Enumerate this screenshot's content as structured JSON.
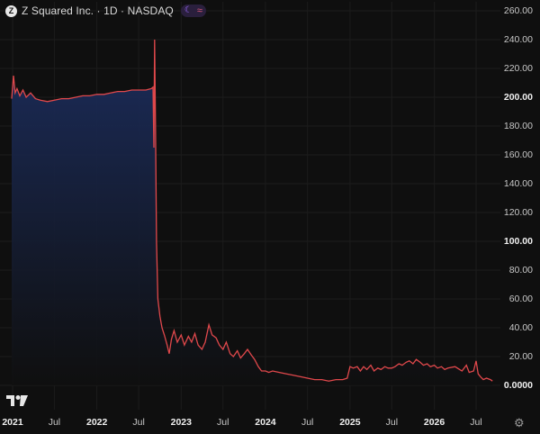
{
  "header": {
    "logo_letter": "Z",
    "title": "Z Squared Inc. · 1D · NASDAQ",
    "moon_icon": "moon-icon",
    "wave_icon": "wave-icon"
  },
  "branding": {
    "tv_logo": "TV"
  },
  "chart_data": {
    "type": "area",
    "line_color": "#e0484b",
    "fill_color": "#1a2a55",
    "ylim": [
      0,
      260
    ],
    "y_ticks": [
      "260.00",
      "240.00",
      "220.00",
      "200.00",
      "180.00",
      "160.00",
      "140.00",
      "120.00",
      "100.00",
      "80.00",
      "60.00",
      "40.00",
      "20.00",
      "0.0000"
    ],
    "y_tick_values": [
      260,
      240,
      220,
      200,
      180,
      160,
      140,
      120,
      100,
      80,
      60,
      40,
      20,
      0
    ],
    "y_bold_ticks": [
      "200.00",
      "100.00",
      "0.0000"
    ],
    "x_ticks": [
      "2021",
      "Jul",
      "2022",
      "Jul",
      "2023",
      "Jul",
      "2024",
      "Jul",
      "2025",
      "Jul",
      "2026",
      "Jul"
    ],
    "x_bold_ticks": [
      "2021",
      "2022",
      "2023",
      "2024",
      "2025",
      "2026"
    ],
    "xlim": [
      "2021-01-01",
      "2026-09-20"
    ],
    "x_tick_dates": [
      "2021-01-01",
      "2021-07-01",
      "2022-01-01",
      "2022-07-01",
      "2023-01-01",
      "2023-07-01",
      "2024-01-01",
      "2024-07-01",
      "2025-01-01",
      "2025-07-01",
      "2026-01-01",
      "2026-07-01"
    ],
    "points": [
      [
        "2020-12-28",
        199
      ],
      [
        "2021-01-05",
        215
      ],
      [
        "2021-01-12",
        203
      ],
      [
        "2021-01-20",
        206
      ],
      [
        "2021-02-01",
        201
      ],
      [
        "2021-02-15",
        205
      ],
      [
        "2021-03-01",
        200
      ],
      [
        "2021-03-20",
        203
      ],
      [
        "2021-04-10",
        199
      ],
      [
        "2021-05-01",
        198
      ],
      [
        "2021-06-01",
        197
      ],
      [
        "2021-07-01",
        198
      ],
      [
        "2021-08-01",
        199
      ],
      [
        "2021-09-01",
        199
      ],
      [
        "2021-10-01",
        200
      ],
      [
        "2021-11-01",
        201
      ],
      [
        "2021-12-01",
        201
      ],
      [
        "2022-01-01",
        202
      ],
      [
        "2022-02-01",
        202
      ],
      [
        "2022-03-01",
        203
      ],
      [
        "2022-04-01",
        204
      ],
      [
        "2022-05-01",
        204
      ],
      [
        "2022-06-01",
        205
      ],
      [
        "2022-07-01",
        205
      ],
      [
        "2022-08-01",
        205
      ],
      [
        "2022-08-25",
        206
      ],
      [
        "2022-09-01",
        207
      ],
      [
        "2022-09-05",
        165
      ],
      [
        "2022-09-08",
        240
      ],
      [
        "2022-09-12",
        180
      ],
      [
        "2022-09-16",
        100
      ],
      [
        "2022-09-22",
        60
      ],
      [
        "2022-10-01",
        48
      ],
      [
        "2022-10-10",
        40
      ],
      [
        "2022-10-20",
        35
      ],
      [
        "2022-11-01",
        28
      ],
      [
        "2022-11-10",
        22
      ],
      [
        "2022-11-20",
        32
      ],
      [
        "2022-12-01",
        38
      ],
      [
        "2022-12-15",
        30
      ],
      [
        "2023-01-01",
        35
      ],
      [
        "2023-01-15",
        28
      ],
      [
        "2023-02-01",
        34
      ],
      [
        "2023-02-15",
        30
      ],
      [
        "2023-03-01",
        36
      ],
      [
        "2023-03-15",
        28
      ],
      [
        "2023-04-01",
        25
      ],
      [
        "2023-04-15",
        30
      ],
      [
        "2023-05-01",
        42
      ],
      [
        "2023-05-15",
        35
      ],
      [
        "2023-06-01",
        33
      ],
      [
        "2023-06-15",
        28
      ],
      [
        "2023-07-01",
        25
      ],
      [
        "2023-07-15",
        30
      ],
      [
        "2023-08-01",
        22
      ],
      [
        "2023-08-15",
        20
      ],
      [
        "2023-09-01",
        24
      ],
      [
        "2023-09-15",
        19
      ],
      [
        "2023-10-01",
        22
      ],
      [
        "2023-10-15",
        25
      ],
      [
        "2023-11-01",
        21
      ],
      [
        "2023-11-15",
        18
      ],
      [
        "2023-12-01",
        13
      ],
      [
        "2023-12-15",
        10
      ],
      [
        "2024-01-01",
        10
      ],
      [
        "2024-01-15",
        9
      ],
      [
        "2024-02-01",
        10
      ],
      [
        "2024-03-01",
        9
      ],
      [
        "2024-04-01",
        8
      ],
      [
        "2024-05-01",
        7
      ],
      [
        "2024-06-01",
        6
      ],
      [
        "2024-07-01",
        5
      ],
      [
        "2024-08-01",
        4
      ],
      [
        "2024-09-01",
        4
      ],
      [
        "2024-10-01",
        3
      ],
      [
        "2024-11-01",
        4
      ],
      [
        "2024-12-01",
        4
      ],
      [
        "2024-12-20",
        5
      ],
      [
        "2025-01-01",
        13
      ],
      [
        "2025-01-15",
        12
      ],
      [
        "2025-02-01",
        13
      ],
      [
        "2025-02-15",
        10
      ],
      [
        "2025-03-01",
        13
      ],
      [
        "2025-03-15",
        11
      ],
      [
        "2025-04-01",
        14
      ],
      [
        "2025-04-15",
        10
      ],
      [
        "2025-05-01",
        12
      ],
      [
        "2025-05-15",
        11
      ],
      [
        "2025-06-01",
        13
      ],
      [
        "2025-06-15",
        12
      ],
      [
        "2025-07-01",
        12
      ],
      [
        "2025-07-15",
        13
      ],
      [
        "2025-08-01",
        15
      ],
      [
        "2025-08-15",
        14
      ],
      [
        "2025-09-01",
        16
      ],
      [
        "2025-09-15",
        17
      ],
      [
        "2025-10-01",
        15
      ],
      [
        "2025-10-15",
        18
      ],
      [
        "2025-11-01",
        16
      ],
      [
        "2025-11-15",
        14
      ],
      [
        "2025-12-01",
        15
      ],
      [
        "2025-12-15",
        13
      ],
      [
        "2026-01-01",
        14
      ],
      [
        "2026-01-15",
        12
      ],
      [
        "2026-02-01",
        13
      ],
      [
        "2026-02-15",
        11
      ],
      [
        "2026-03-01",
        12
      ],
      [
        "2026-04-01",
        13
      ],
      [
        "2026-05-01",
        10
      ],
      [
        "2026-05-20",
        14
      ],
      [
        "2026-06-01",
        9
      ],
      [
        "2026-06-20",
        10
      ],
      [
        "2026-07-01",
        17
      ],
      [
        "2026-07-10",
        8
      ],
      [
        "2026-07-20",
        6
      ],
      [
        "2026-08-01",
        4
      ],
      [
        "2026-08-15",
        5
      ],
      [
        "2026-09-01",
        4
      ],
      [
        "2026-09-10",
        3
      ]
    ]
  }
}
